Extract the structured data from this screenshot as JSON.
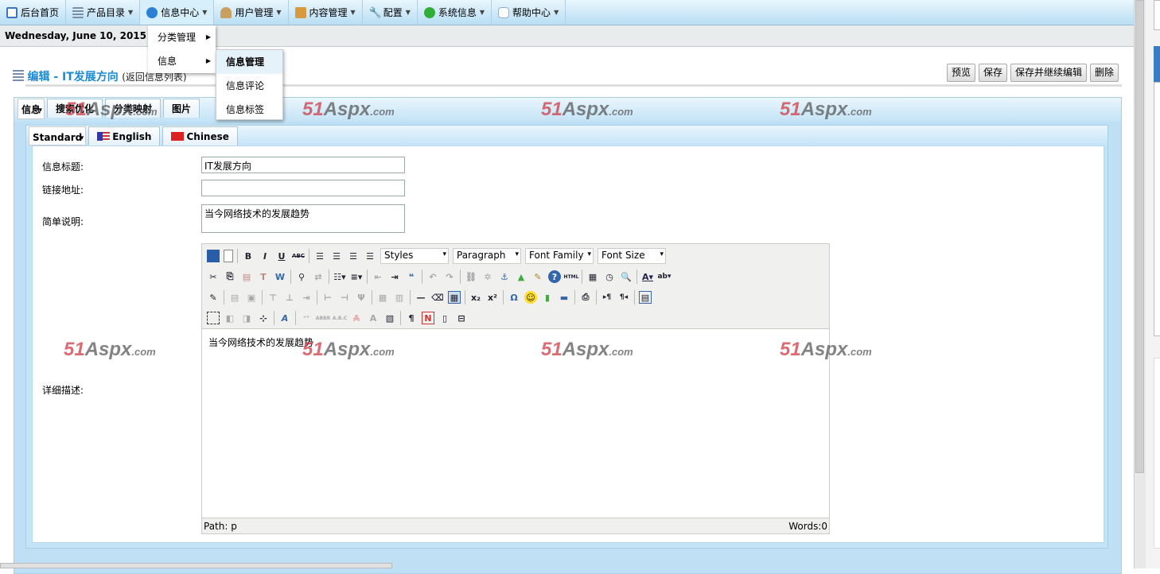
{
  "nav": {
    "items": [
      {
        "label": "后台首页",
        "icon": "home-grid-icon",
        "color": "#3a76c4",
        "dropdown": false
      },
      {
        "label": "产品目录",
        "icon": "list-icon",
        "color": "#7a8fa6",
        "dropdown": true
      },
      {
        "label": "信息中心",
        "icon": "info-icon",
        "color": "#2d7fd6",
        "dropdown": true
      },
      {
        "label": "用户管理",
        "icon": "user-icon",
        "color": "#c9a060",
        "dropdown": true
      },
      {
        "label": "内容管理",
        "icon": "folder-icon",
        "color": "#d89a40",
        "dropdown": true
      },
      {
        "label": "配置",
        "icon": "wrench-icon",
        "color": "#8a8a8a",
        "dropdown": true
      },
      {
        "label": "系统信息",
        "icon": "green-status-icon",
        "color": "#2fae3a",
        "dropdown": true
      },
      {
        "label": "帮助中心",
        "icon": "chat-icon",
        "color": "#90b0d0",
        "dropdown": true
      }
    ]
  },
  "date": "Wednesday, June 10, 2015 10:1",
  "menu": {
    "items": [
      "分类管理",
      "信息"
    ],
    "submenu": [
      "信息管理",
      "信息评论",
      "信息标签"
    ],
    "active_sub": "信息管理"
  },
  "header": {
    "title": "编辑 - IT发展方向",
    "back": "(返回信息列表)"
  },
  "buttons": {
    "preview": "预览",
    "save": "保存",
    "save_continue": "保存并继续编辑",
    "delete": "删除"
  },
  "tabs": [
    "信息",
    "搜索优化",
    "分类映射",
    "图片"
  ],
  "lang_tabs": [
    "Standard",
    "English",
    "Chinese"
  ],
  "form": {
    "title_label": "信息标题:",
    "title_value": "IT发展方向",
    "link_label": "链接地址:",
    "link_value": "",
    "summary_label": "简单说明:",
    "summary_value": "当今网络技术的发展趋势",
    "detail_label": "详细描述:"
  },
  "editor": {
    "styles": "Styles",
    "paragraph": "Paragraph",
    "font_family": "Font Family",
    "font_size": "Font Size",
    "content": "当今网络技术的发展趋势",
    "path": "Path: p",
    "words": "Words:0"
  },
  "watermark": {
    "num": "51",
    "brand": "Aspx",
    ".com": ".com"
  }
}
